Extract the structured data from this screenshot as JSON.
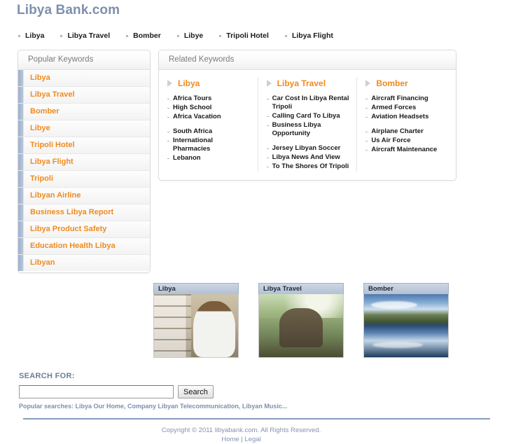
{
  "header": {
    "title": "Libya Bank.com"
  },
  "top_nav": [
    {
      "label": "Libya"
    },
    {
      "label": "Libya Travel"
    },
    {
      "label": "Bomber"
    },
    {
      "label": "Libye"
    },
    {
      "label": "Tripoli Hotel"
    },
    {
      "label": "Libya Flight"
    }
  ],
  "sidebar": {
    "heading": "Popular Keywords",
    "items": [
      {
        "label": "Libya"
      },
      {
        "label": "Libya Travel"
      },
      {
        "label": "Bomber"
      },
      {
        "label": "Libye"
      },
      {
        "label": "Tripoli Hotel"
      },
      {
        "label": "Libya Flight"
      },
      {
        "label": "Tripoli"
      },
      {
        "label": "Libyan Airline"
      },
      {
        "label": "Business Libya Report"
      },
      {
        "label": "Libya Product Safety"
      },
      {
        "label": "Education Health Libya"
      },
      {
        "label": "Libyan"
      }
    ]
  },
  "related": {
    "heading": "Related Keywords",
    "columns": [
      {
        "title": "Libya",
        "items": [
          "Africa Tours",
          "High School",
          "Africa Vacation",
          "South Africa",
          "International Pharmacies",
          "Lebanon"
        ]
      },
      {
        "title": "Libya Travel",
        "items": [
          "Car Cost In Libya Rental Tripoli",
          "Calling Card To Libya",
          "Business Libya Opportunity",
          "Jersey Libyan Soccer",
          "Libya News And View",
          "To The Shores Of Tripoli"
        ]
      },
      {
        "title": "Bomber",
        "items": [
          "Aircraft Financing",
          "Armed Forces",
          "Aviation Headsets",
          "Airplane Charter",
          "Us Air Force",
          "Aircraft Maintenance"
        ]
      }
    ]
  },
  "cards": [
    {
      "title": "Libya",
      "image": "pharmacy-shelves-photo"
    },
    {
      "title": "Libya Travel",
      "image": "travellers-hut-photo"
    },
    {
      "title": "Bomber",
      "image": "mountain-lake-photo"
    }
  ],
  "search": {
    "label": "SEARCH FOR:",
    "value": "",
    "placeholder": "",
    "button_label": "Search",
    "popular": "Popular searches: Libya Our Home, Company Libyan Telecommunication, Libyan Music..."
  },
  "footer": {
    "copyright": "Copyright © 2011 libyabank.com. All Rights Reserved.",
    "home_label": "Home",
    "separator": "|",
    "legal_label": "Legal"
  },
  "colors": {
    "accent_orange": "#f08a1e",
    "title_blue": "#7f8fad",
    "rule_blue": "#8a9bbd"
  }
}
